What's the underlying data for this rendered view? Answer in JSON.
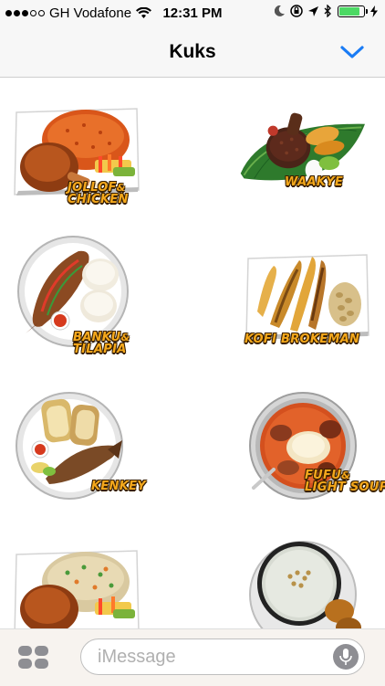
{
  "status": {
    "carrier": "GH Vodafone",
    "time": "12:31 PM",
    "battery_level": 0.85,
    "icons": [
      "signal-dots-icon",
      "wifi-icon",
      "moon-icon",
      "rotation-lock-icon",
      "location-arrow-icon",
      "bluetooth-icon",
      "battery-icon",
      "charging-bolt-icon"
    ]
  },
  "navbar": {
    "title": "Kuks",
    "collapse_icon": "chevron-down-icon",
    "accent": "#1a7cf5"
  },
  "stickers": [
    {
      "name": "jollof-chicken",
      "line1": "JOLLOF",
      "amp": "&",
      "line2": "CHICKEN"
    },
    {
      "name": "waakye",
      "line1": "WAAKYE"
    },
    {
      "name": "banku-tilapia",
      "line1": "BANKU",
      "amp": "&",
      "line2": "TILAPIA"
    },
    {
      "name": "kofi-brokeman",
      "line1": "KOFI BROKEMAN"
    },
    {
      "name": "kenkey",
      "line1": "KENKEY"
    },
    {
      "name": "fufu-light-soup",
      "line1": "FUFU",
      "amp": "&",
      "line2": "LIGHT SOUP"
    },
    {
      "name": "fried-rice-chicken",
      "line1": ""
    },
    {
      "name": "porridge-koose",
      "line1": ""
    }
  ],
  "bottombar": {
    "placeholder": "iMessage",
    "apps_icon": "app-drawer-icon",
    "mic_icon": "microphone-icon"
  }
}
